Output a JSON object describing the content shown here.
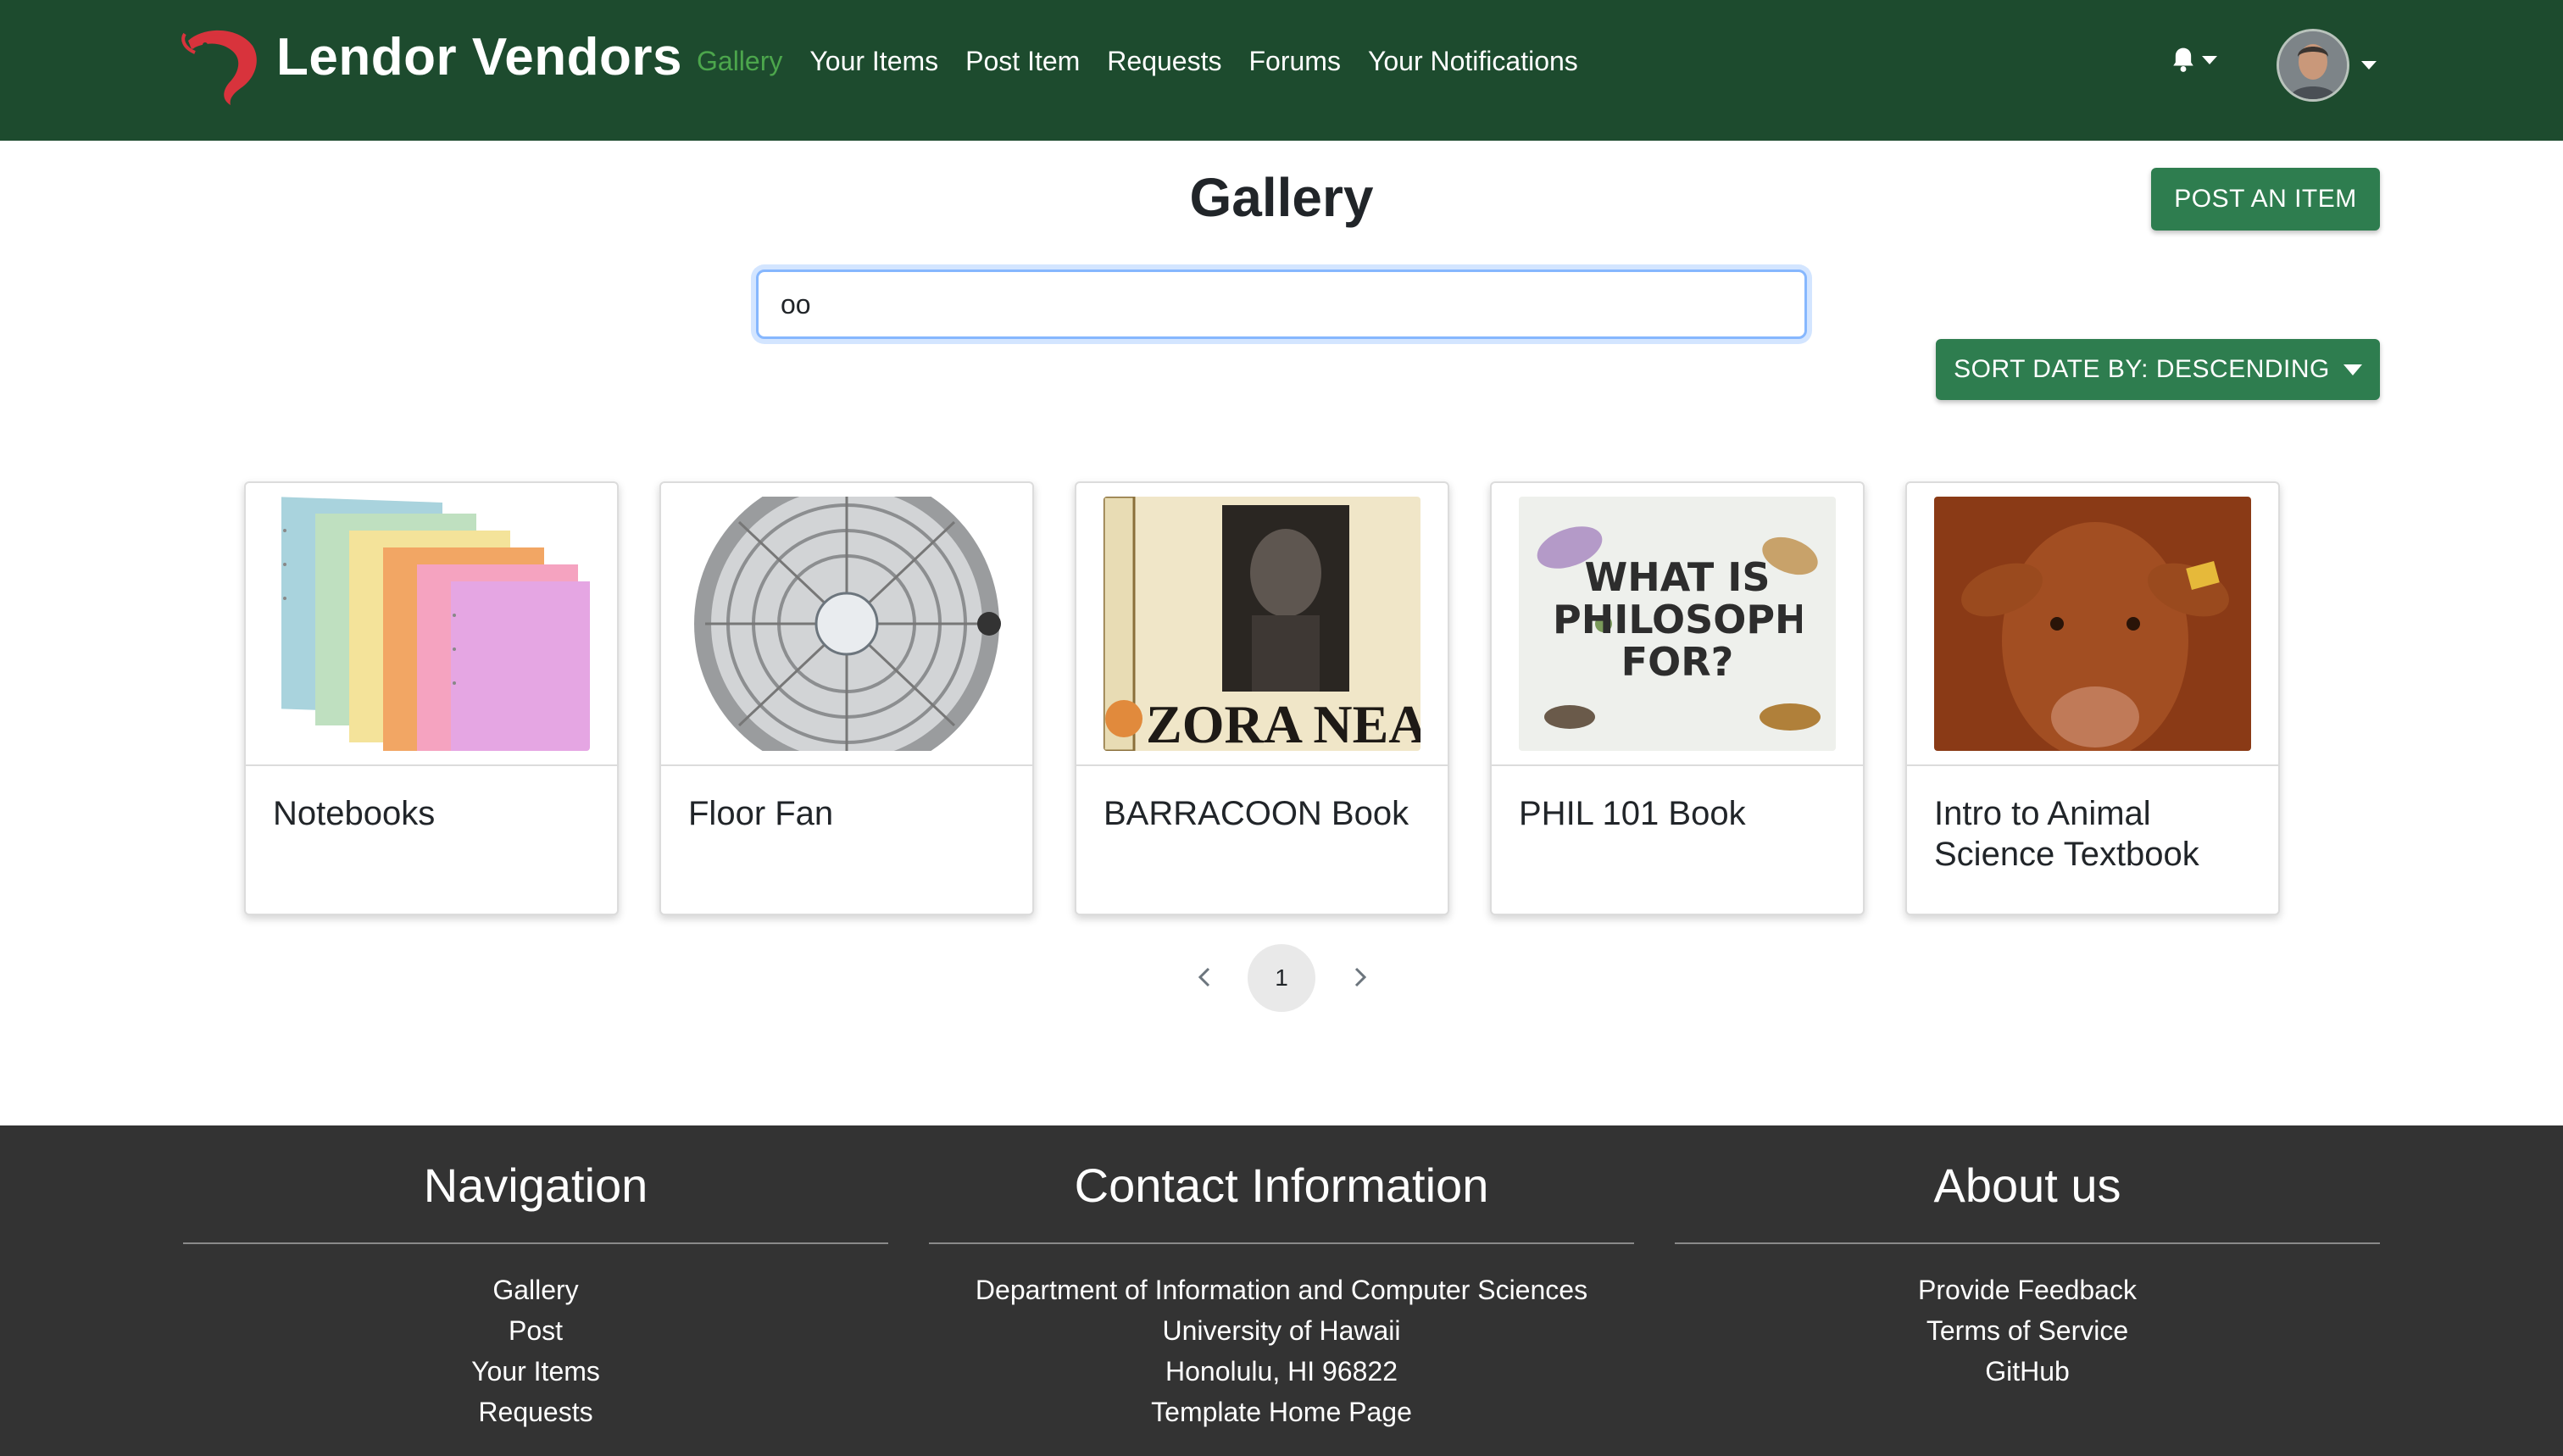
{
  "brand": {
    "name": "Lendor Vendors",
    "logo_icon": "shrimp-logo-icon",
    "logo_color": "#d8333c"
  },
  "nav": {
    "links": [
      "Gallery",
      "Your Items",
      "Post Item",
      "Requests",
      "Forums",
      "Your Notifications"
    ],
    "active": "Gallery",
    "bell_icon": "bell-icon"
  },
  "colors": {
    "navbar": "#1d4b2e",
    "active_link": "#4ca64c",
    "button": "#2e7d4f",
    "footer": "#333333"
  },
  "page": {
    "title": "Gallery"
  },
  "search": {
    "value": "oo"
  },
  "buttons": {
    "post_item": "POST AN ITEM",
    "sort": "SORT DATE BY: DESCENDING"
  },
  "items": [
    {
      "title": "Notebooks",
      "image": "spiral-notebooks"
    },
    {
      "title": "Floor Fan",
      "image": "floor-fan"
    },
    {
      "title": "BARRACOON Book",
      "image": "barracoon-book-cover",
      "cover_text": "ZORA NEALE"
    },
    {
      "title": "PHIL 101 Book",
      "image": "philosophy-book-cover",
      "cover_text": "WHAT IS PHILOSOPHY FOR?"
    },
    {
      "title": "Intro to Animal Science Textbook",
      "image": "cow-textbook-cover"
    }
  ],
  "pagination": {
    "current": "1"
  },
  "footer": {
    "navigation": {
      "title": "Navigation",
      "items": [
        "Gallery",
        "Post",
        "Your Items",
        "Requests"
      ]
    },
    "contact": {
      "title": "Contact Information",
      "items": [
        "Department of Information and Computer Sciences",
        "University of Hawaii",
        "Honolulu, HI 96822",
        "Template Home Page"
      ]
    },
    "about": {
      "title": "About us",
      "items": [
        "Provide Feedback",
        "Terms of Service",
        "GitHub"
      ]
    }
  }
}
